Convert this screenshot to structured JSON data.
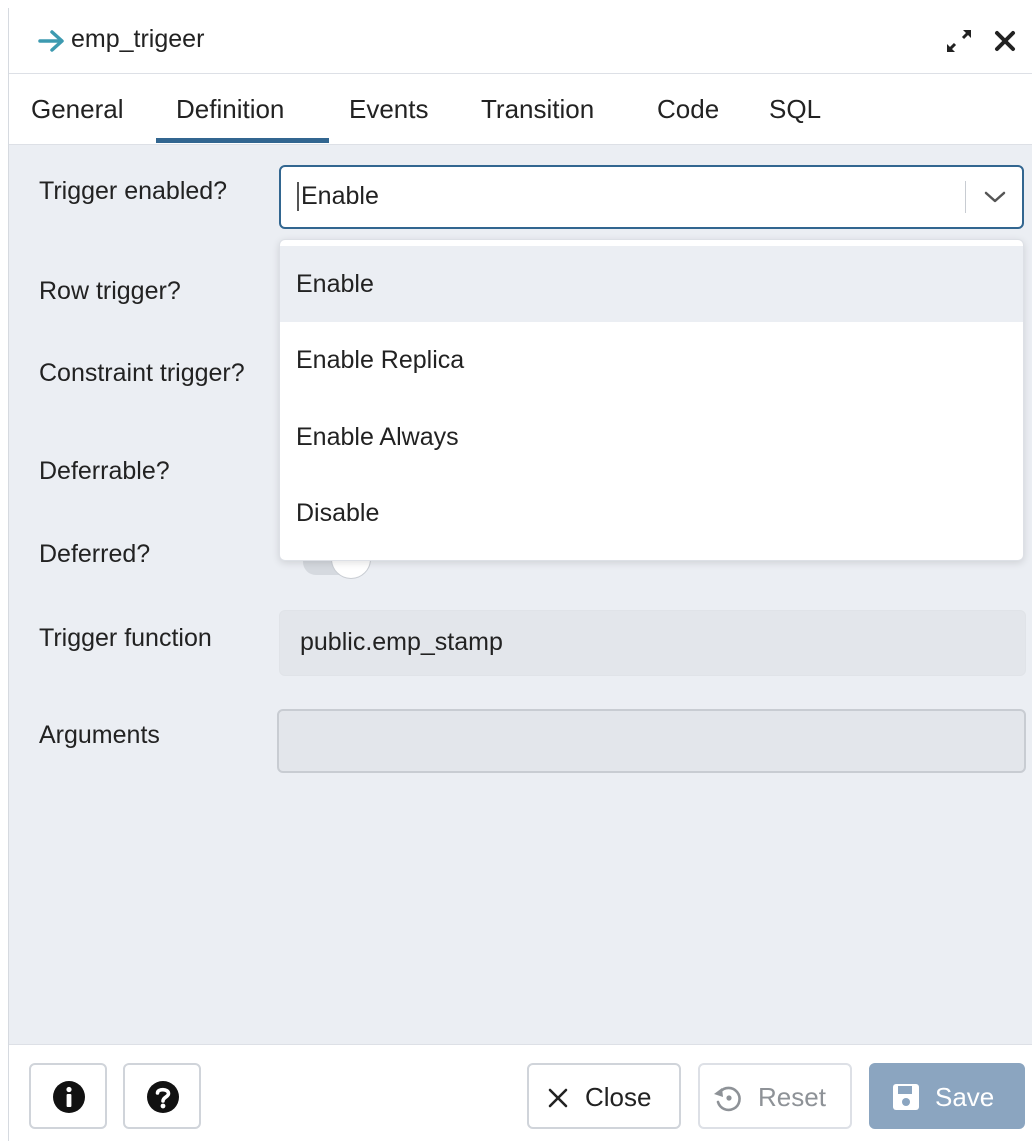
{
  "dialog": {
    "title": "emp_trigeer"
  },
  "tabs": [
    {
      "label": "General"
    },
    {
      "label": "Definition",
      "active": true
    },
    {
      "label": "Events"
    },
    {
      "label": "Transition"
    },
    {
      "label": "Code"
    },
    {
      "label": "SQL"
    }
  ],
  "form": {
    "trigger_enabled_label": "Trigger enabled?",
    "trigger_enabled_value": "Enable",
    "trigger_enabled_options": [
      "Enable",
      "Enable Replica",
      "Enable Always",
      "Disable"
    ],
    "row_trigger_label": "Row trigger?",
    "constraint_trigger_label": "Constraint trigger?",
    "deferrable_label": "Deferrable?",
    "deferred_label": "Deferred?",
    "trigger_function_label": "Trigger function",
    "trigger_function_value": "public.emp_stamp",
    "arguments_label": "Arguments",
    "arguments_value": ""
  },
  "footer": {
    "close_label": "Close",
    "reset_label": "Reset",
    "save_label": "Save"
  },
  "icons": {
    "title": "arrow-right-icon",
    "expand": "expand-icon",
    "close": "close-icon",
    "info": "info-icon",
    "help": "help-icon",
    "reset": "reset-icon",
    "save": "save-icon"
  },
  "colors": {
    "accent": "#326690",
    "title_arrow": "#3d9ab0",
    "save_button": "#8ba5c0",
    "panel_bg": "#ebeef3"
  }
}
